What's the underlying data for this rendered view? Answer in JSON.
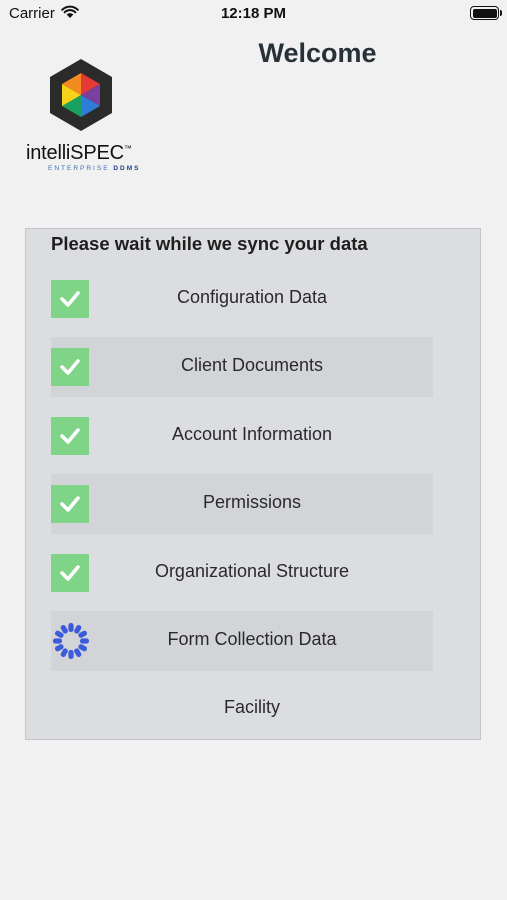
{
  "status_bar": {
    "carrier": "Carrier",
    "time": "12:18 PM"
  },
  "header": {
    "title": "Welcome"
  },
  "logo": {
    "name": "intelliSPEC",
    "trademark": "™",
    "subtitle_a": "ENTERPRISE",
    "subtitle_b": "DDMS"
  },
  "sync": {
    "heading": "Please wait while we sync your data",
    "items": [
      {
        "label": "Configuration Data",
        "status": "done"
      },
      {
        "label": "Client Documents",
        "status": "done"
      },
      {
        "label": "Account Information",
        "status": "done"
      },
      {
        "label": "Permissions",
        "status": "done"
      },
      {
        "label": "Organizational Structure",
        "status": "done"
      },
      {
        "label": "Form Collection Data",
        "status": "loading"
      },
      {
        "label": "Facility",
        "status": "pending"
      }
    ]
  },
  "colors": {
    "check": "#7fd488",
    "spinner": "#3b5bdb",
    "panel": "#dcdde0",
    "row_alt": "#d2d4d7"
  }
}
